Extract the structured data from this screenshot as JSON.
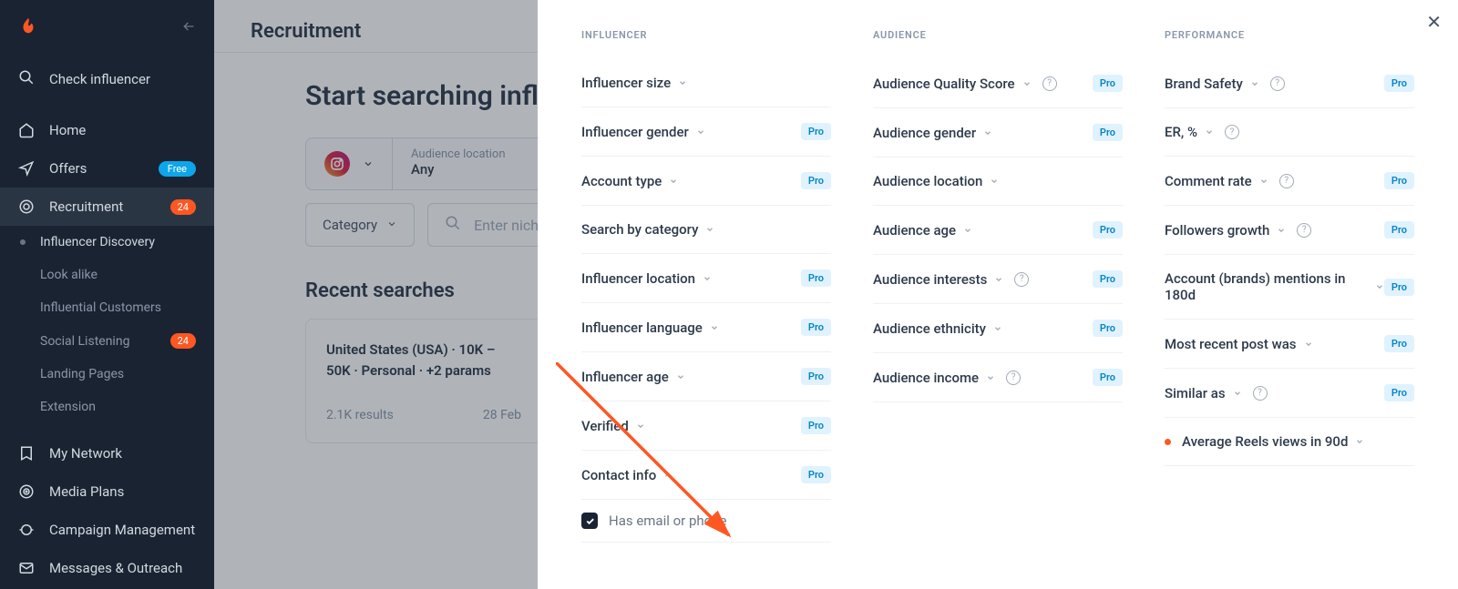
{
  "sidebar": {
    "check": "Check influencer",
    "items": [
      {
        "label": "Home"
      },
      {
        "label": "Offers",
        "badge_type": "free",
        "badge": "Free"
      },
      {
        "label": "Recruitment",
        "badge_type": "num",
        "badge": "24"
      }
    ],
    "subs": [
      {
        "label": "Influencer Discovery",
        "active": true
      },
      {
        "label": "Look alike"
      },
      {
        "label": "Influential Customers"
      },
      {
        "label": "Social Listening",
        "badge": "24"
      },
      {
        "label": "Landing Pages"
      },
      {
        "label": "Extension"
      }
    ],
    "bottom": [
      {
        "label": "My Network"
      },
      {
        "label": "Media Plans"
      },
      {
        "label": "Campaign Management"
      },
      {
        "label": "Messages & Outreach"
      }
    ]
  },
  "main": {
    "header": "Recruitment",
    "title": "Start searching influencers",
    "audience_label": "Audience location",
    "audience_val": "Any",
    "category": "Category",
    "search_ph": "Enter niche keywords",
    "recent_heading": "Recent searches",
    "recent_card": {
      "title": "United States (USA) · 10K – 50K · Personal · +2 params",
      "results": "2.1K results",
      "date": "28 Feb"
    }
  },
  "panel": {
    "columns": [
      {
        "head": "INFLUENCER",
        "filters": [
          {
            "name": "Influencer size"
          },
          {
            "name": "Influencer gender",
            "pro": true
          },
          {
            "name": "Account type",
            "pro": true
          },
          {
            "name": "Search by category"
          },
          {
            "name": "Influencer location",
            "pro": true
          },
          {
            "name": "Influencer language",
            "pro": true
          },
          {
            "name": "Influencer age",
            "pro": true
          },
          {
            "name": "Verified",
            "pro": true
          },
          {
            "name": "Contact info",
            "pro": true,
            "expanded": true,
            "sub": "Has email or phone"
          }
        ]
      },
      {
        "head": "AUDIENCE",
        "filters": [
          {
            "name": "Audience Quality Score",
            "info": true,
            "pro": true
          },
          {
            "name": "Audience gender",
            "pro": true
          },
          {
            "name": "Audience location"
          },
          {
            "name": "Audience age",
            "pro": true
          },
          {
            "name": "Audience interests",
            "info": true,
            "pro": true
          },
          {
            "name": "Audience ethnicity",
            "pro": true
          },
          {
            "name": "Audience income",
            "info": true,
            "pro": true
          }
        ]
      },
      {
        "head": "PERFORMANCE",
        "filters": [
          {
            "name": "Brand Safety",
            "info": true,
            "pro": true
          },
          {
            "name": "ER, %",
            "info": true
          },
          {
            "name": "Comment rate",
            "info": true,
            "pro": true
          },
          {
            "name": "Followers growth",
            "info": true,
            "pro": true
          },
          {
            "name": "Account (brands) mentions in 180d",
            "pro": true
          },
          {
            "name": "Most recent post was",
            "pro": true
          },
          {
            "name": "Similar as",
            "info": true,
            "pro": true
          },
          {
            "name": "Average Reels views in 90d",
            "dot": true
          }
        ]
      }
    ]
  },
  "pro_label": "Pro"
}
